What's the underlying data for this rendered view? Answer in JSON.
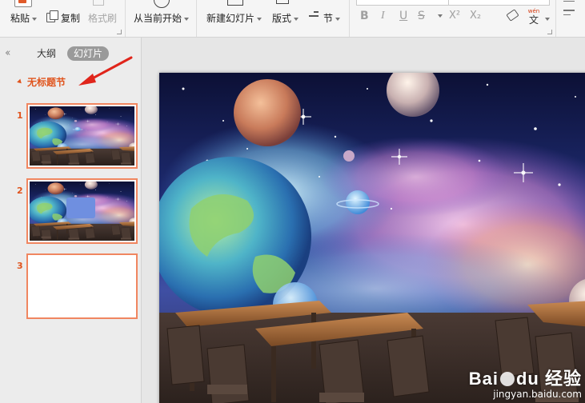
{
  "ribbon": {
    "paste_label": "粘贴",
    "copy_label": "复制",
    "format_painter_label": "格式刷",
    "play_from_current_label": "从当前开始",
    "new_slide_label": "新建幻灯片",
    "layout_label": "版式",
    "section_label": "节",
    "bold": "B",
    "italic": "I",
    "underline": "U",
    "strike": "S",
    "superscript": "X²",
    "subscript": "X₂",
    "phonetic_top": "wén",
    "phonetic_char": "文"
  },
  "left_pane": {
    "tab_outline": "大纲",
    "tab_slides": "幻灯片",
    "section_title": "无标题节",
    "slides": [
      {
        "number": "1"
      },
      {
        "number": "2"
      },
      {
        "number": "3"
      }
    ]
  },
  "watermark": {
    "brand": "Bai",
    "brand_tail": "du",
    "brand_suffix": "经验",
    "url": "jingyan.baidu.com"
  },
  "colors": {
    "accent": "#e0541d",
    "thumb_border": "#f08660",
    "placeholder_box": "#6f8fe0"
  }
}
